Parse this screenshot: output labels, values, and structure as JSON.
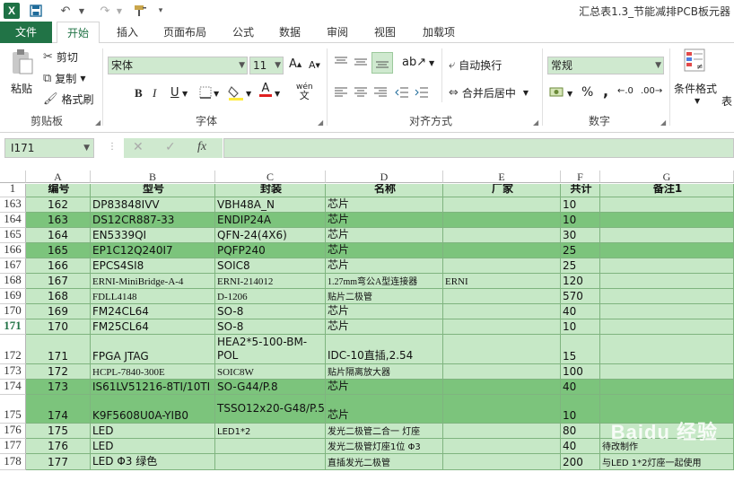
{
  "titlebar": {
    "app_logo": "X",
    "doc_title": "汇总表1.3_节能减排PCB板元器",
    "icons": [
      "save-icon",
      "undo-icon",
      "redo-icon",
      "format-painter-icon",
      "customize-qat-icon"
    ]
  },
  "tabs": [
    "文件",
    "开始",
    "插入",
    "页面布局",
    "公式",
    "数据",
    "审阅",
    "视图",
    "加载项"
  ],
  "ribbon": {
    "clipboard": {
      "paste": "粘贴",
      "cut": "剪切",
      "copy": "复制",
      "format_painter": "格式刷",
      "label": "剪贴板"
    },
    "font": {
      "name": "宋体",
      "size": "11",
      "bold": "B",
      "italic": "I",
      "underline": "U",
      "phonetic": "wén",
      "font_color_letter": "A",
      "label": "字体"
    },
    "alignment": {
      "wrap_text": "自动换行",
      "merge_center": "合并后居中",
      "label": "对齐方式"
    },
    "number": {
      "format": "常规",
      "percent": "%",
      "comma": ",",
      "label": "数字"
    },
    "styles": {
      "conditional_format": "条件格式",
      "table_format": "表"
    }
  },
  "formula_bar": {
    "name_box": "I171",
    "cancel": "✕",
    "enter": "✓",
    "fx": "fx",
    "value": ""
  },
  "columns": [
    "A",
    "B",
    "C",
    "D",
    "E",
    "F",
    "G"
  ],
  "header_row": {
    "row": "1",
    "cells": [
      "编号",
      "型号",
      "封装",
      "名称",
      "厂家",
      "共计",
      "备注1"
    ]
  },
  "rows": [
    {
      "row": "163",
      "cells": [
        "162",
        "DP83848IVV",
        "VBH48A_N",
        "芯片",
        "",
        "10",
        ""
      ]
    },
    {
      "row": "164",
      "cells": [
        "163",
        "DS12CR887-33",
        "ENDIP24A",
        "芯片",
        "",
        "10",
        ""
      ]
    },
    {
      "row": "165",
      "cells": [
        "164",
        "EN5339QI",
        "QFN-24(4X6)",
        "芯片",
        "",
        "30",
        ""
      ]
    },
    {
      "row": "166",
      "cells": [
        "165",
        "EP1C12Q240I7",
        "PQFP240",
        "芯片",
        "",
        "25",
        ""
      ]
    },
    {
      "row": "167",
      "cells": [
        "166",
        "EPCS4SI8",
        "SOIC8",
        "芯片",
        "",
        "25",
        ""
      ]
    },
    {
      "row": "168",
      "cells": [
        "167",
        "ERNI-MiniBridge-A-4",
        "ERNI-214012",
        "1.27mm弯公A型连接器",
        "ERNI",
        "120",
        ""
      ]
    },
    {
      "row": "169",
      "cells": [
        "168",
        "FDLL4148",
        "D-1206",
        "贴片二极管",
        "",
        "570",
        ""
      ]
    },
    {
      "row": "170",
      "cells": [
        "169",
        "FM24CL64",
        "SO-8",
        "芯片",
        "",
        "40",
        ""
      ]
    },
    {
      "row": "171",
      "cells": [
        "170",
        "FM25CL64",
        "SO-8",
        "芯片",
        "",
        "10",
        ""
      ]
    },
    {
      "row": "172",
      "cells": [
        "171",
        "FPGA JTAG",
        "HEA2*5-100-BM-POL",
        "IDC-10直插,2.54",
        "",
        "15",
        ""
      ]
    },
    {
      "row": "173",
      "cells": [
        "172",
        "HCPL-7840-300E",
        "SOIC8W",
        "贴片隔离放大器",
        "",
        "100",
        ""
      ]
    },
    {
      "row": "174",
      "cells": [
        "173",
        "IS61LV51216-8TI/10TI",
        "SO-G44/P.8",
        "芯片",
        "",
        "40",
        ""
      ]
    },
    {
      "row": "175",
      "cells": [
        "174",
        "K9F5608U0A-YIB0",
        "TSSO12x20-G48/P.5",
        "芯片",
        "",
        "10",
        ""
      ]
    },
    {
      "row": "176",
      "cells": [
        "175",
        "LED",
        "LED1*2",
        "发光二极管二合一 灯座",
        "",
        "80",
        ""
      ]
    },
    {
      "row": "177",
      "cells": [
        "176",
        "LED",
        "",
        "发光二极管灯座1位 Φ3",
        "",
        "40",
        "待改制作"
      ]
    },
    {
      "row": "178",
      "cells": [
        "177",
        "LED Φ3 绿色",
        "",
        "直插发光二极管",
        "",
        "200",
        "与LED 1*2灯座一起使用"
      ]
    }
  ],
  "watermark": "Baidu 经验",
  "colors": {
    "brand": "#217346",
    "cell_light": "#c6e8c6",
    "cell_dark": "#7cc47c"
  }
}
